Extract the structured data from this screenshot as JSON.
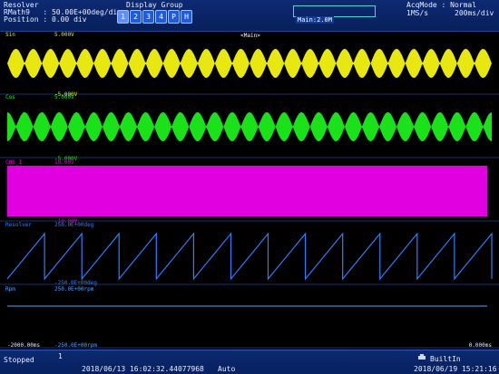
{
  "header": {
    "channel_name": "Resolver",
    "scale_label": "RMath9   : 50.00E+00deg/div",
    "position_label": "Position : 0.00 div",
    "display_group_title": "Display Group",
    "display_group_buttons": [
      "1",
      "2",
      "3",
      "4",
      "P",
      "H"
    ],
    "acq_mode": "AcqMode : Normal",
    "sample_rate": "1MS/s",
    "time_div": "200ms/div",
    "main_zoom": "Main:2.0M",
    "top_center_label": "<Main>"
  },
  "channels": [
    {
      "name": "Sin",
      "color": "#e8e810",
      "top_scale": "5.000V",
      "bottom_scale": "-5.000V"
    },
    {
      "name": "Cos",
      "color": "#19e219",
      "top_scale": "5.000V",
      "bottom_scale": "-5.000V"
    },
    {
      "name": "CH3_1",
      "color": "#e000e0",
      "top_scale": "10.00V",
      "bottom_scale": "-10.00V"
    },
    {
      "name": "Resolver",
      "color": "#2a7fff",
      "top_scale": "250.0E+00deg",
      "bottom_scale": "-250.0E+00deg"
    },
    {
      "name": "Rpm",
      "color": "#4da3ff",
      "top_scale": "250.0E+00rpm",
      "bottom_scale": "-250.0E+00rpm"
    }
  ],
  "time_axis": {
    "start_label": "-2000.00ms",
    "end_label": "0.000ms"
  },
  "footer": {
    "status": "Stopped",
    "count": "1",
    "trigger_time": "2018/06/13 16:02:32.44077968",
    "trigger_mode": "Auto",
    "storage": "BuiltIn",
    "current_time": "2018/06/19 15:21:16"
  },
  "colors": {
    "header_bg": "#0a246a",
    "grid": "#16306b",
    "sin": "#e8e810",
    "cos": "#19e219",
    "ch3": "#e000e0",
    "resolver": "#2a7fff"
  }
}
